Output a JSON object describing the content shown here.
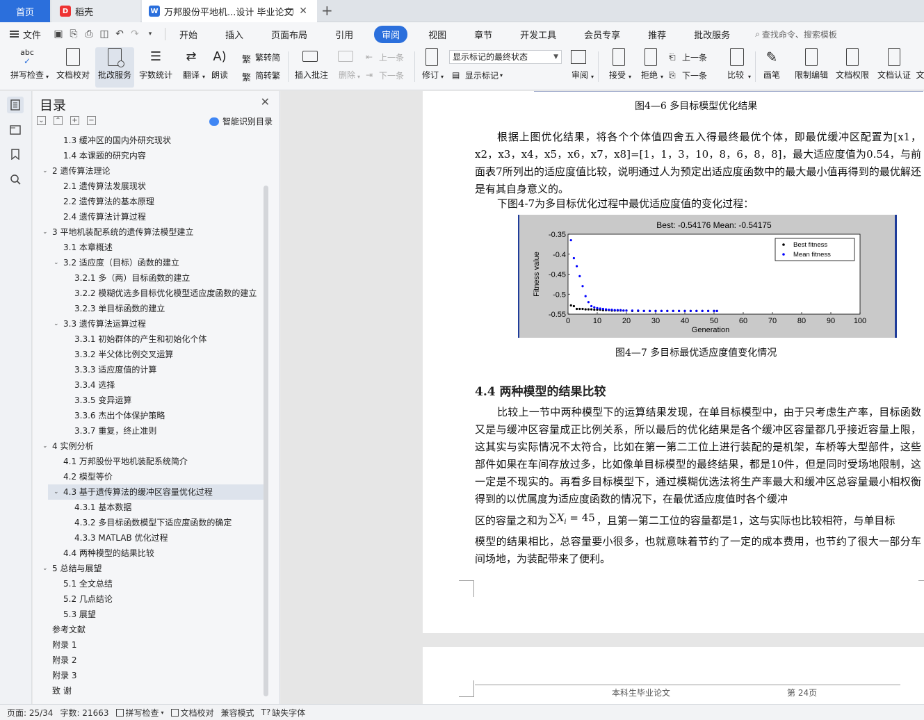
{
  "tabs": {
    "home": "首页",
    "daoke": "稻壳",
    "doc": "万邦股份平地机...设计 毕业论文"
  },
  "menubar": {
    "file": "文件",
    "items": [
      "开始",
      "插入",
      "页面布局",
      "引用",
      "审阅",
      "视图",
      "章节",
      "开发工具",
      "会员专享",
      "推荐",
      "批改服务"
    ],
    "active": "审阅",
    "search": "查找命令、搜索模板"
  },
  "ribbon": {
    "spell": "拼写检查",
    "proof": "文档校对",
    "correct": "批改服务",
    "count": "字数统计",
    "translate": "翻译",
    "read": "朗读",
    "trad": "繁转简",
    "simp": "简转繁",
    "insert_comment": "插入批注",
    "delete": "删除",
    "prev_comment": "上一条",
    "next_comment": "下一条",
    "track": "修订",
    "markup_state": "显示标记的最终状态",
    "show_markup": "显示标记",
    "review": "审阅",
    "accept": "接受",
    "reject": "拒绝",
    "prev_change": "上一条",
    "next_change": "下一条",
    "compare": "比较",
    "pen": "画笔",
    "restrict": "限制编辑",
    "rights": "文档权限",
    "cert": "文档认证",
    "more": "文"
  },
  "toc": {
    "title": "目录",
    "smart": "智能识别目录",
    "items": [
      {
        "t": "1.3  缓冲区的国内外研究现状",
        "lv": 1
      },
      {
        "t": "1.4  本课题的研究内容",
        "lv": 1
      },
      {
        "t": "2  遗传算法理论",
        "lv": 0,
        "c": true
      },
      {
        "t": "2.1  遗传算法发展现状",
        "lv": 1
      },
      {
        "t": "2.2  遗传算法的基本原理",
        "lv": 1
      },
      {
        "t": "2.4  遗传算法计算过程",
        "lv": 1
      },
      {
        "t": "3 平地机装配系统的遗传算法模型建立",
        "lv": 0,
        "c": true
      },
      {
        "t": "3.1    本章概述",
        "lv": 1
      },
      {
        "t": "3.2    适应度（目标）函数的建立",
        "lv": 1,
        "c": true
      },
      {
        "t": "3.2.1    多（两）目标函数的建立",
        "lv": 2
      },
      {
        "t": "3.2.2    模糊优选多目标优化模型适应度函数的建立",
        "lv": 2
      },
      {
        "t": "3.2.3    单目标函数的建立",
        "lv": 2
      },
      {
        "t": "3.3    遗传算法运算过程",
        "lv": 1,
        "c": true
      },
      {
        "t": "3.3.1    初始群体的产生和初始化个体",
        "lv": 2
      },
      {
        "t": "3.3.2    半父体比例交叉运算",
        "lv": 2
      },
      {
        "t": "3.3.3    适应度值的计算",
        "lv": 2
      },
      {
        "t": "3.3.4    选择",
        "lv": 2
      },
      {
        "t": "3.3.5    变异运算",
        "lv": 2
      },
      {
        "t": "3.3.6    杰出个体保护策略",
        "lv": 2
      },
      {
        "t": "3.3.7    重复，终止准则",
        "lv": 2
      },
      {
        "t": "4  实例分析",
        "lv": 0,
        "c": true
      },
      {
        "t": "4.1    万邦股份平地机装配系统简介",
        "lv": 1
      },
      {
        "t": "4.2    模型等价",
        "lv": 1
      },
      {
        "t": "4.3    基于遗传算法的缓冲区容量优化过程",
        "lv": 1,
        "c": true,
        "hl": true
      },
      {
        "t": "4.3.1    基本数据",
        "lv": 2
      },
      {
        "t": "4.3.2    多目标函数模型下适应度函数的确定",
        "lv": 2
      },
      {
        "t": "4.3.3    MATLAB 优化过程",
        "lv": 2
      },
      {
        "t": "4.4    两种模型的结果比较",
        "lv": 1
      },
      {
        "t": "5  总结与展望",
        "lv": 0,
        "c": true
      },
      {
        "t": "5.1    全文总结",
        "lv": 1
      },
      {
        "t": "5.2    几点结论",
        "lv": 1
      },
      {
        "t": "5.3    展望",
        "lv": 1
      },
      {
        "t": "参考文献",
        "lv": 0
      },
      {
        "t": "附录 1",
        "lv": 0
      },
      {
        "t": "附录 2",
        "lv": 0
      },
      {
        "t": "附录 3",
        "lv": 0
      },
      {
        "t": "致    谢",
        "lv": 0
      }
    ]
  },
  "doc": {
    "cap46": "图4—6    多目标模型优化结果",
    "p1": "根据上图优化结果，将各个个体值四舍五入得最终最优个体，即最优缓冲区配置为[x1，x2，x3，x4，x5，x6，x7，x8]=[1，1，3，10，8，6，8，8]，最大适应度值为0.54，与前面表7所列出的适应度值比较，说明通过人为预定出适应度函数中的最大最小值再得到的最优解还是有其自身意义的。",
    "p2": "下图4-7为多目标优化过程中最优适应度值的变化过程：",
    "cap47": "图4—7    多目标最优适应度值变化情况",
    "h44": "4.4    两种模型的结果比较",
    "p3a": "比较上一节中两种模型下的运算结果发现，在单目标模型中，由于只考虑生产率，目标函数又是与缓冲区容量成正比例关系，所以最后的优化结果是各个缓冲区容量都几乎接近容量上限，这其实与实际情况不太符合，比如在第一第二工位上进行装配的是机架，车桥等大型部件，这些部件如果在车间存放过多，比如像单目标模型的最终结果，都是10件，但是同时受场地限制，这一定是不现实的。再看多目标模型下，通过模糊优选法将生产率最大和缓冲区总容量最小相权衡得到的以优属度为适应度函数的情况下，在最优适应度值时各个缓冲",
    "p3b1": "区的容量之和为",
    "formula": "∑X",
    "formula_sub": "i",
    "formula_eq": " = 45",
    "p3b2": "，且第一第二工位的容量都是1，这与实际也比较相符，与单目标",
    "p3c": "模型的结果相比，总容量要小很多，也就意味着节约了一定的成本费用，也节约了很大一部分车间场地，为装配带来了便利。",
    "footer_left": "本科生毕业论文",
    "footer_right": "第 24页"
  },
  "chart_data": {
    "type": "scatter",
    "title": "Best: -0.54176 Mean: -0.54175",
    "xlabel": "Generation",
    "ylabel": "Fitness value",
    "xlim": [
      0,
      100
    ],
    "ylim": [
      -0.55,
      -0.35
    ],
    "xticks": [
      "0",
      "10",
      "20",
      "30",
      "40",
      "50",
      "60",
      "70",
      "80",
      "90",
      "100"
    ],
    "yticks": [
      "-0.35",
      "-0.4",
      "-0.45",
      "-0.5",
      "-0.55"
    ],
    "legend_position": "top-right",
    "series": [
      {
        "name": "Best fitness",
        "color": "#000000",
        "x": [
          1,
          2,
          3,
          4,
          5,
          6,
          7,
          8,
          9,
          10,
          11,
          12,
          13,
          14,
          15,
          16,
          17,
          18,
          19,
          20,
          22,
          24,
          26,
          28,
          30,
          32,
          34,
          36,
          38,
          40,
          42,
          44,
          46,
          48,
          50,
          51
        ],
        "y": [
          -0.528,
          -0.53,
          -0.537,
          -0.537,
          -0.537,
          -0.538,
          -0.538,
          -0.538,
          -0.539,
          -0.539,
          -0.539,
          -0.54,
          -0.54,
          -0.54,
          -0.541,
          -0.541,
          -0.541,
          -0.541,
          -0.541,
          -0.541,
          -0.542,
          -0.542,
          -0.542,
          -0.542,
          -0.542,
          -0.542,
          -0.542,
          -0.542,
          -0.542,
          -0.542,
          -0.542,
          -0.542,
          -0.542,
          -0.542,
          -0.542,
          -0.542
        ]
      },
      {
        "name": "Mean fitness",
        "color": "#0000ff",
        "x": [
          1,
          2,
          3,
          4,
          5,
          6,
          7,
          8,
          9,
          10,
          11,
          12,
          13,
          14,
          15,
          16,
          17,
          18,
          19,
          20,
          22,
          24,
          26,
          28,
          30,
          32,
          34,
          36,
          38,
          40,
          42,
          44,
          46,
          48,
          50,
          51
        ],
        "y": [
          -0.365,
          -0.41,
          -0.43,
          -0.455,
          -0.48,
          -0.505,
          -0.52,
          -0.53,
          -0.533,
          -0.535,
          -0.536,
          -0.537,
          -0.538,
          -0.539,
          -0.539,
          -0.54,
          -0.54,
          -0.54,
          -0.541,
          -0.541,
          -0.541,
          -0.541,
          -0.542,
          -0.542,
          -0.542,
          -0.542,
          -0.542,
          -0.542,
          -0.542,
          -0.542,
          -0.542,
          -0.542,
          -0.542,
          -0.542,
          -0.542,
          -0.542
        ]
      }
    ]
  },
  "status": {
    "page": "页面: 25/34",
    "words": "字数: 21663",
    "spell": "拼写检查",
    "proof": "文档校对",
    "compat": "兼容模式",
    "font": "缺失字体"
  }
}
